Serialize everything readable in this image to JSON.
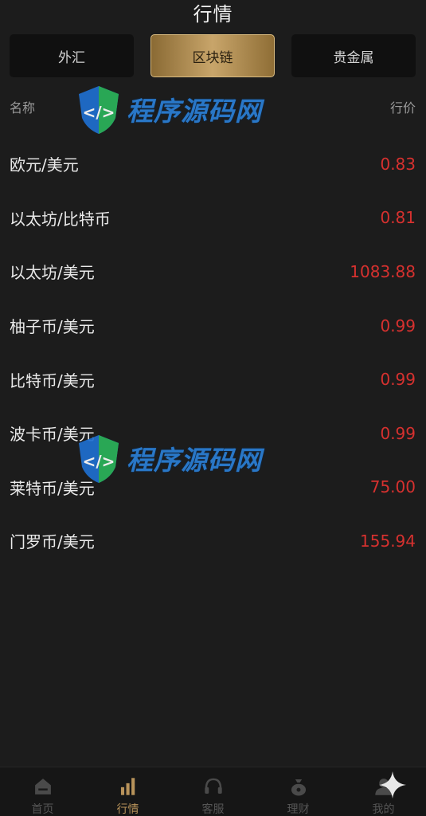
{
  "header": {
    "title": "行情"
  },
  "tabs": [
    {
      "label": "外汇",
      "active": false
    },
    {
      "label": "区块链",
      "active": true
    },
    {
      "label": "贵金属",
      "active": false
    }
  ],
  "list_header": {
    "name": "名称",
    "price": "行价"
  },
  "rows": [
    {
      "name": "欧元/美元",
      "price": "0.83"
    },
    {
      "name": "以太坊/比特币",
      "price": "0.81"
    },
    {
      "name": "以太坊/美元",
      "price": "1083.88"
    },
    {
      "name": "柚子币/美元",
      "price": "0.99"
    },
    {
      "name": "比特币/美元",
      "price": "0.99"
    },
    {
      "name": "波卡币/美元",
      "price": "0.99"
    },
    {
      "name": "莱特币/美元",
      "price": "75.00"
    },
    {
      "name": "门罗币/美元",
      "price": "155.94"
    }
  ],
  "watermark": {
    "text": "程序源码网"
  },
  "tabbar": [
    {
      "label": "首页",
      "icon": "home-icon"
    },
    {
      "label": "行情",
      "icon": "chart-bars-icon"
    },
    {
      "label": "客服",
      "icon": "headset-icon"
    },
    {
      "label": "理财",
      "icon": "money-bag-icon"
    },
    {
      "label": "我的",
      "icon": "user-icon"
    }
  ],
  "colors": {
    "background": "#1c1c1c",
    "price_red": "#d6312f",
    "tab_active_gold": "#c8a56a",
    "watermark_blue": "#2b7fd6"
  }
}
